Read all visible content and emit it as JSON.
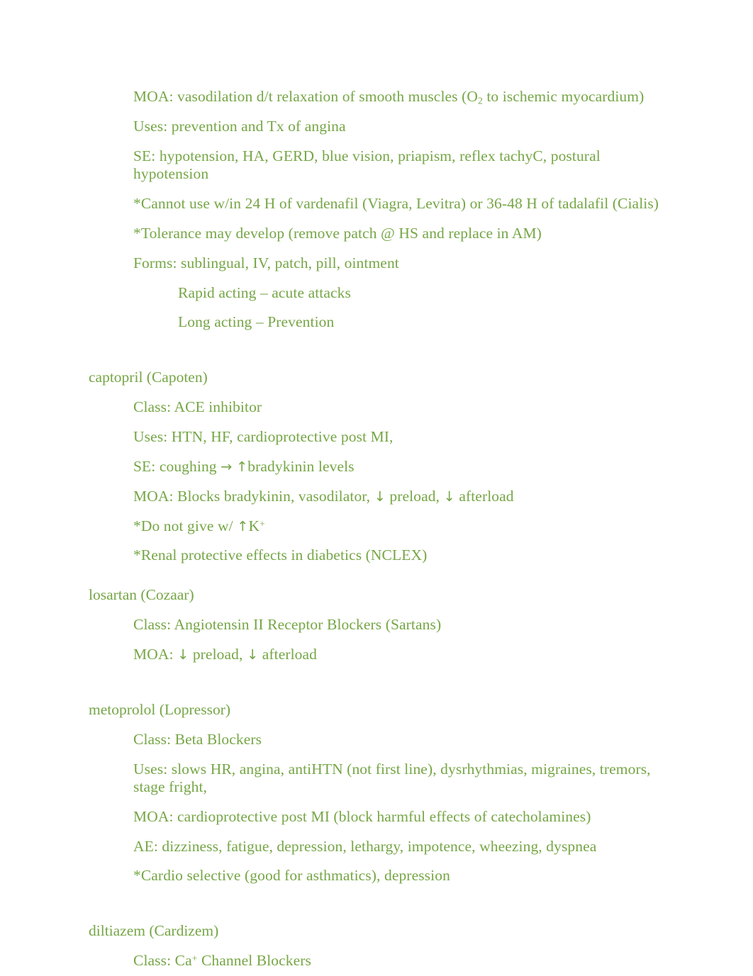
{
  "document": {
    "text_color": "#76a646",
    "background_color": "#ffffff",
    "sections": [
      {
        "id": "nitroglycerin-continued",
        "lines": [
          {
            "indent": 1,
            "text": "MOA: vasodilation d/t relaxation of smooth muscles (O₂ to ischemic myocardium)"
          },
          {
            "indent": 1,
            "text": "Uses: prevention and Tx of angina"
          },
          {
            "indent": 1,
            "text": "SE: hypotension, HA, GERD, blue vision, priapism, reflex tachyC, postural hypotension"
          },
          {
            "indent": 1,
            "text": "*Cannot use w/in 24 H of vardenafil (Viagra, Levitra) or 36-48 H of tadalafil (Cialis)"
          },
          {
            "indent": 1,
            "text": "*Tolerance may develop (remove patch @ HS and replace in AM)"
          },
          {
            "indent": 1,
            "text": "Forms: sublingual, IV, patch, pill, ointment"
          },
          {
            "indent": 2,
            "text": "Rapid acting – acute attacks"
          },
          {
            "indent": 2,
            "text": "Long acting – Prevention"
          }
        ]
      },
      {
        "id": "captopril",
        "heading": "captopril (Capoten)",
        "lines": [
          {
            "indent": 1,
            "text": "Class: ACE inhibitor"
          },
          {
            "indent": 1,
            "text": "Uses: HTN, HF, cardioprotective post MI,"
          },
          {
            "indent": 1,
            "text": "SE: coughing → ↑bradykinin levels"
          },
          {
            "indent": 1,
            "text": "MOA: Blocks bradykinin, vasodilator, ↓ preload, ↓ afterload"
          },
          {
            "indent": 1,
            "text": "*Do not give w/ ↑K⁺"
          },
          {
            "indent": 1,
            "text": "*Renal protective effects in diabetics (NCLEX)"
          }
        ]
      },
      {
        "id": "losartan",
        "heading": "losartan (Cozaar)",
        "lines": [
          {
            "indent": 1,
            "text": "Class: Angiotensin II Receptor Blockers (Sartans)"
          },
          {
            "indent": 1,
            "text": "MOA: ↓ preload, ↓ afterload"
          }
        ]
      },
      {
        "id": "metoprolol",
        "heading": "metoprolol (Lopressor)",
        "lines": [
          {
            "indent": 1,
            "text": "Class: Beta Blockers"
          },
          {
            "indent": 1,
            "text": "Uses: slows HR, angina, antiHTN (not first line), dysrhythmias, migraines, tremors, stage fright,"
          },
          {
            "indent": 1,
            "text": "MOA: cardioprotective post MI (block harmful effects of catecholamines)"
          },
          {
            "indent": 1,
            "text": "AE: dizziness, fatigue, depression, lethargy, impotence, wheezing, dyspnea"
          },
          {
            "indent": 1,
            "text": "*Cardio selective (good for asthmatics), depression"
          }
        ]
      },
      {
        "id": "diltiazem",
        "heading": "diltiazem (Cardizem)",
        "lines": [
          {
            "indent": 1,
            "text": "Class: Ca⁺ Channel Blockers"
          }
        ]
      }
    ],
    "rich": {
      "moa_vasodilation": {
        "pre": "MOA: vasodilation d/t relaxation of smooth muscles (O",
        "sub": "2",
        "post": " to ischemic myocardium)"
      },
      "se_coughing": {
        "pre": "SE: coughing ",
        "arrow_right": "→",
        "mid": " ",
        "arrow_up": "↑",
        "post": "bradykinin levels"
      },
      "moa_blocks": {
        "pre": "MOA: Blocks bradykinin, vasodilator, ",
        "arrow_down1": "↓",
        "mid": " preload, ",
        "arrow_down2": "↓",
        "post": " afterload"
      },
      "do_not_give": {
        "pre": "*Do not give w/ ",
        "arrow_up": "↑",
        "mid": "K",
        "sup": "+"
      },
      "moa_losartan": {
        "pre": "MOA: ",
        "arrow_down1": "↓",
        "mid": " preload, ",
        "arrow_down2": "↓",
        "post": " afterload"
      },
      "class_ca": {
        "pre": "Class: Ca",
        "sup": "+",
        "post": " Channel Blockers"
      }
    }
  }
}
